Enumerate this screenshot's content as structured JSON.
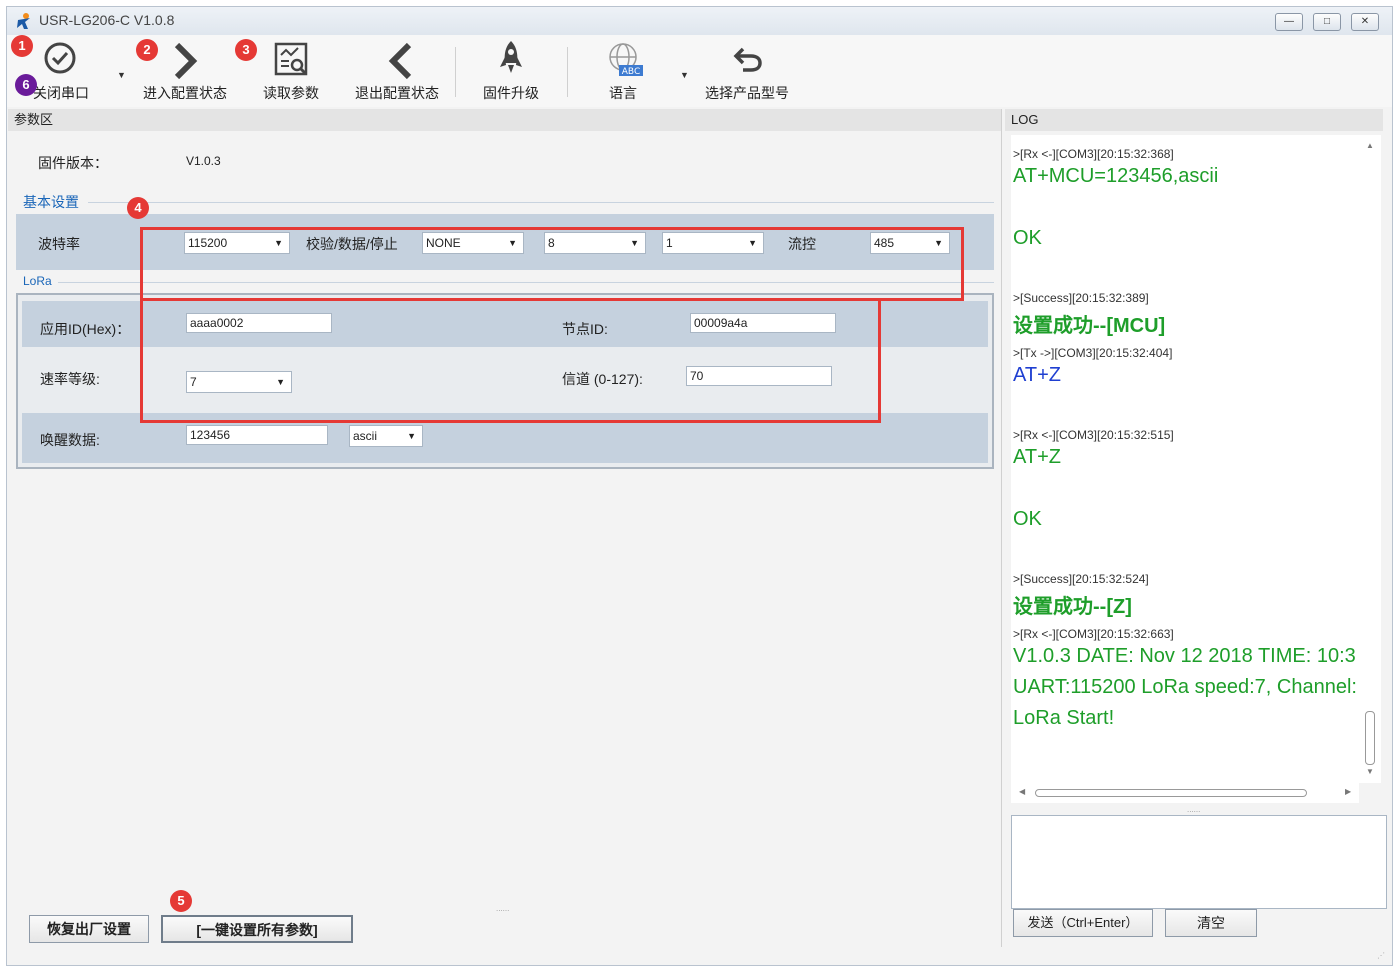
{
  "window": {
    "title": "USR-LG206-C  V1.0.8"
  },
  "toolbar": {
    "close_port": "关闭串口",
    "enter_config": "进入配置状态",
    "read_params": "读取参数",
    "exit_config": "退出配置状态",
    "firmware_upgrade": "固件升级",
    "language": "语言",
    "select_model": "选择产品型号"
  },
  "badges": {
    "b1": "1",
    "b2": "2",
    "b3": "3",
    "b4": "4",
    "b5": "5",
    "b6": "6"
  },
  "params": {
    "header": "参数区",
    "firmware_label": "固件版本：",
    "firmware_value": "V1.0.3",
    "basic_title": "基本设置",
    "baud_label": "波特率",
    "baud_value": "115200",
    "parity_label": "校验/数据/停止",
    "parity_value": "NONE",
    "data_bits": "8",
    "stop_bits": "1",
    "flow_label": "流控",
    "flow_value": "485",
    "lora_title": "LoRa",
    "app_id_label": "应用ID(Hex)：",
    "app_id_value": "aaaa0002",
    "node_id_label": "节点ID:",
    "node_id_value": "00009a4a",
    "rate_label": "速率等级:",
    "rate_value": "7",
    "channel_label": "信道 (0-127):",
    "channel_value": "70",
    "wake_label": "唤醒数据:",
    "wake_value": "123456",
    "wake_format": "ascii",
    "restore_btn": "恢复出厂设置",
    "set_all_btn": "[一键设置所有参数]"
  },
  "log": {
    "header": "LOG",
    "lines": [
      ">[Rx <-][COM3][20:15:32:368]",
      "AT+MCU=123456,ascii",
      "OK",
      ">[Success][20:15:32:389]",
      "设置成功--[MCU]",
      ">[Tx ->][COM3][20:15:32:404]",
      "AT+Z",
      ">[Rx <-][COM3][20:15:32:515]",
      "AT+Z",
      "OK",
      ">[Success][20:15:32:524]",
      "设置成功--[Z]",
      ">[Rx <-][COM3][20:15:32:663]",
      "V1.0.3 DATE: Nov 12 2018 TIME: 10:3",
      "UART:115200 LoRa speed:7, Channel:",
      "LoRa Start!"
    ],
    "send_btn": "发送（Ctrl+Enter）",
    "clear_btn": "清空"
  },
  "colors": {
    "success_green": "#1e9e2a",
    "tx_blue": "#1f3fd1",
    "row_blue": "#c5d1de",
    "annotation_red": "#e53935"
  }
}
